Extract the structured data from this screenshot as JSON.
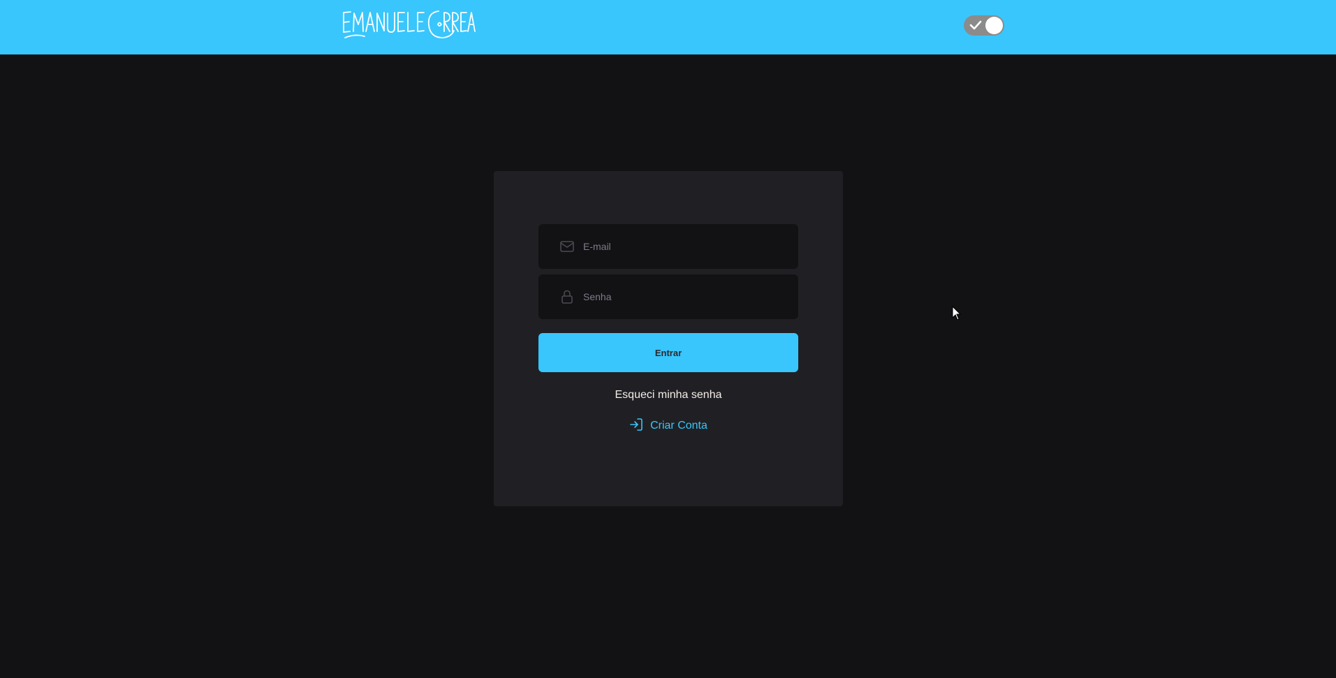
{
  "header": {
    "logo_text": "EMANUELE CORREA",
    "background_color": "#39c6fc",
    "theme_toggle": {
      "state": "on",
      "icon": "check-icon"
    }
  },
  "login_form": {
    "email": {
      "placeholder": "E-mail",
      "value": "",
      "icon": "mail-icon"
    },
    "password": {
      "placeholder": "Senha",
      "value": "",
      "icon": "lock-icon"
    },
    "submit_label": "Entrar",
    "forgot_password_label": "Esqueci minha senha",
    "create_account_label": "Criar Conta",
    "create_account_icon": "log-in-icon"
  },
  "colors": {
    "accent": "#39c6fc",
    "page_background": "#121214",
    "card_background": "#202024",
    "input_background": "#121214"
  }
}
